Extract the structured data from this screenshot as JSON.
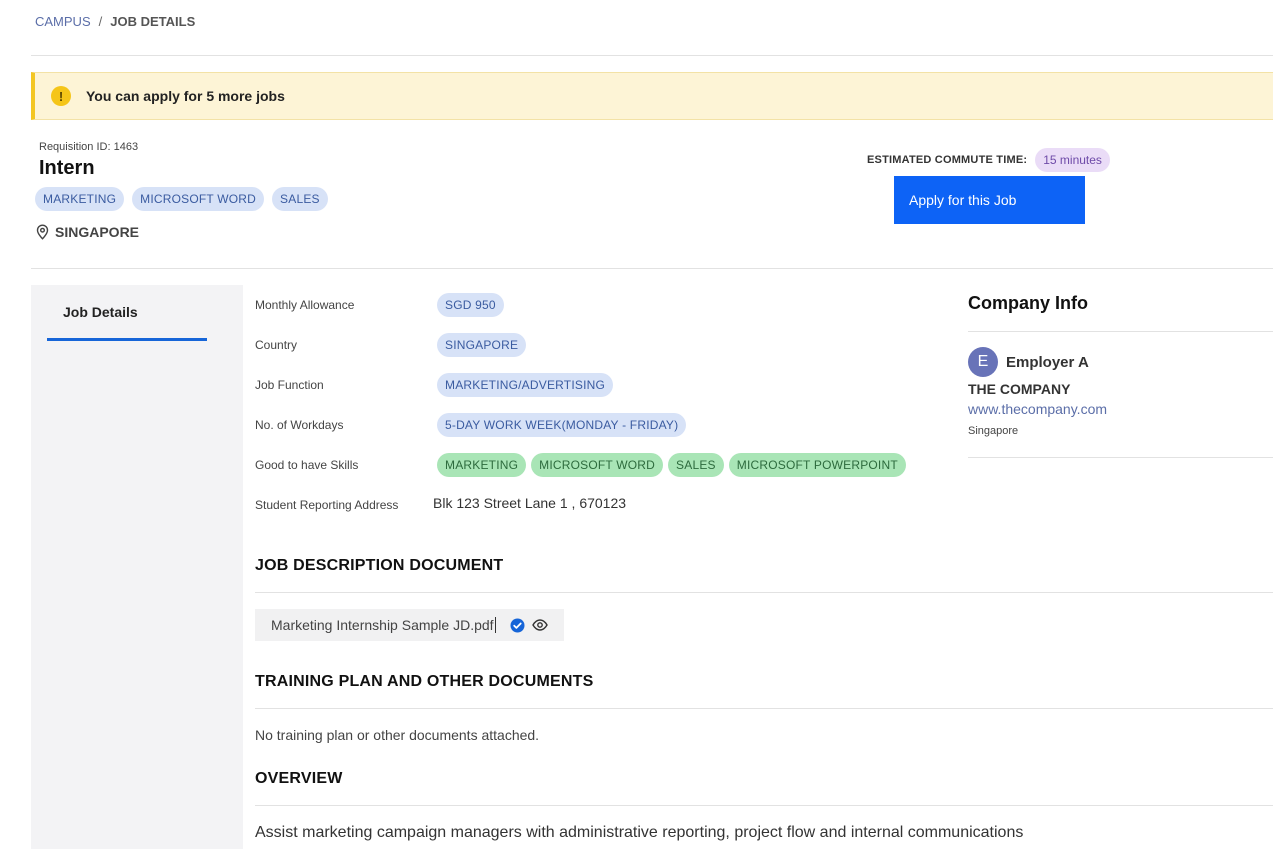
{
  "breadcrumb": {
    "root": "CAMPUS",
    "separator": "/",
    "current": "JOB DETAILS"
  },
  "alert": {
    "icon": "!",
    "text": "You can apply for 5 more jobs"
  },
  "job": {
    "requisition": "Requisition ID: 1463",
    "title": "Intern",
    "tags": [
      "MARKETING",
      "MICROSOFT WORD",
      "SALES"
    ],
    "location": "SINGAPORE"
  },
  "commute": {
    "label": "ESTIMATED COMMUTE TIME:",
    "value": "15 minutes"
  },
  "apply_button": "Apply for this Job",
  "side_tab": "Job Details",
  "details": {
    "monthly_allowance": {
      "label": "Monthly Allowance",
      "value": "SGD 950"
    },
    "country": {
      "label": "Country",
      "value": "SINGAPORE"
    },
    "job_function": {
      "label": "Job Function",
      "value": "MARKETING/ADVERTISING"
    },
    "workdays": {
      "label": "No. of Workdays",
      "value": "5-DAY WORK WEEK(MONDAY - FRIDAY)"
    },
    "skills": {
      "label": "Good to have Skills",
      "values": [
        "MARKETING",
        "MICROSOFT WORD",
        "SALES",
        "MICROSOFT POWERPOINT"
      ]
    },
    "address": {
      "label": "Student Reporting Address",
      "value": "Blk 123 Street Lane 1 , 670123"
    }
  },
  "sections": {
    "jd_title": "JOB DESCRIPTION DOCUMENT",
    "jd_file": "Marketing Internship Sample JD.pdf",
    "training_title": "TRAINING PLAN AND OTHER DOCUMENTS",
    "training_text": "No training plan or other documents attached.",
    "overview_title": "OVERVIEW",
    "overview_text": "Assist marketing campaign managers with administrative reporting, project flow and internal  communications"
  },
  "company": {
    "title": "Company Info",
    "avatar_letter": "E",
    "employer": "Employer A",
    "name": "THE COMPANY",
    "website": "www.thecompany.com",
    "location": "Singapore"
  },
  "colors": {
    "primary": "#0d63f6",
    "alert_bg": "#fdf4d6",
    "tag_blue": "#d7e2f7",
    "tag_green": "#a9e5b6",
    "commute_badge": "#eadcf7"
  }
}
